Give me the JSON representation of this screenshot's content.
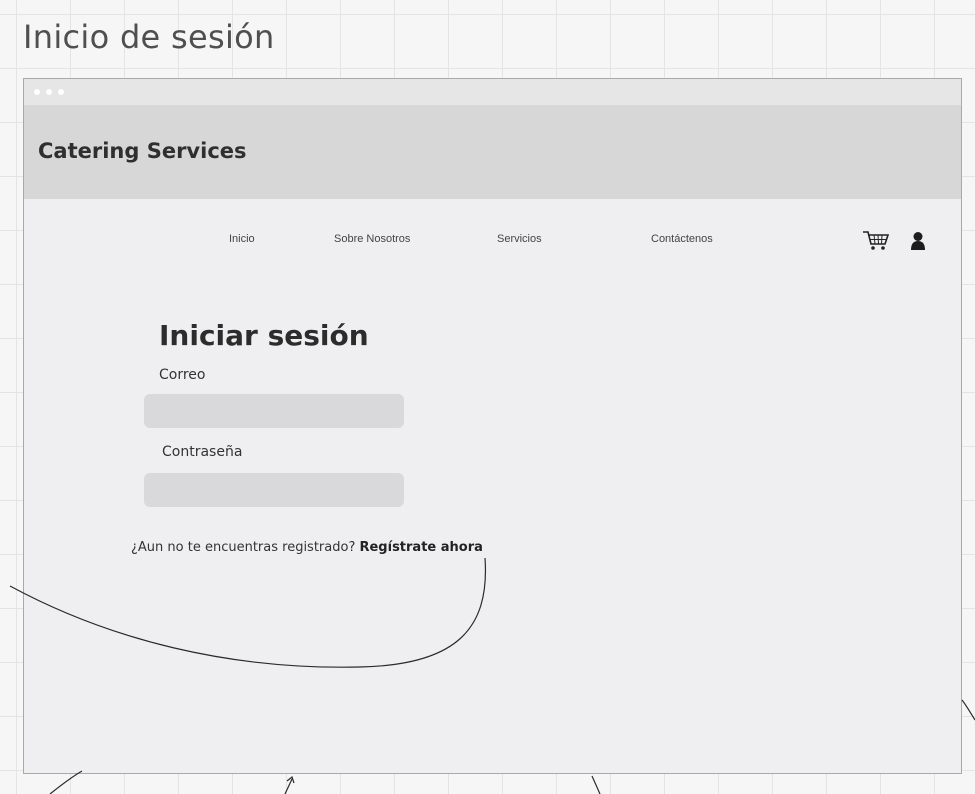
{
  "frame": {
    "title": "Inicio de sesión"
  },
  "header": {
    "brand": "Catering Services"
  },
  "nav": {
    "items": [
      {
        "label": "Inicio"
      },
      {
        "label": "Sobre Nosotros"
      },
      {
        "label": "Servicios"
      },
      {
        "label": "Contáctenos"
      }
    ],
    "icons": [
      "cart-icon",
      "user-icon"
    ]
  },
  "login": {
    "title": "Iniciar sesión",
    "email_label": "Correo",
    "email_value": "",
    "password_label": "Contraseña",
    "password_value": "",
    "register_prompt": "¿Aun no te encuentras registrado?",
    "register_link": "Regístrate ahora"
  },
  "colors": {
    "canvas": "#f6f6f6",
    "window": "#efeff1",
    "header": "#d7d7d7",
    "input": "#d9d9db"
  }
}
